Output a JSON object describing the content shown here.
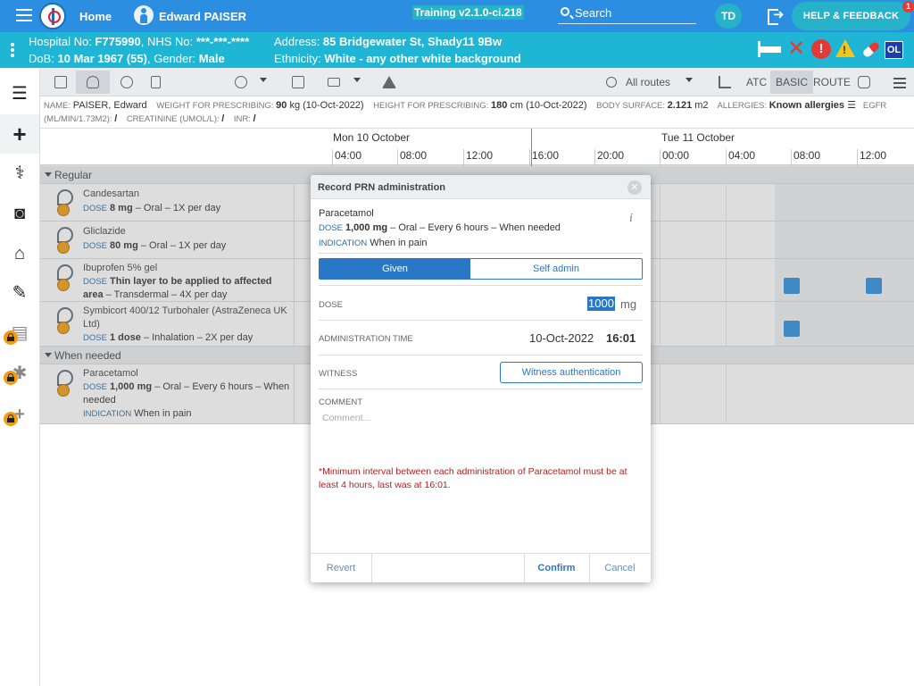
{
  "topbar": {
    "home_label": "Home",
    "patient_name": "Edward PAISER",
    "build": "Training v2.1.0-ci.218",
    "search_label": "Search",
    "user_initials": "TD",
    "help_label": "HELP & FEEDBACK",
    "notification_count": "1"
  },
  "banner": {
    "line1_left_k1": "Hospital No: ",
    "line1_left_v1": "F775990",
    "line1_left_k2": ", NHS No: ",
    "line1_left_v2": "***-***-****",
    "line2_left_k1": "DoB: ",
    "line2_left_v1": "10 Mar 1967 (55)",
    "line2_left_k2": ", Gender: ",
    "line2_left_v2": "Male",
    "line1_right_k": "Address: ",
    "line1_right_v": "85 Bridgewater St, Shady11 9Bw",
    "line2_right_k": "Ethnicity: ",
    "line2_right_v": "White - any other white background",
    "ol_badge": "OL"
  },
  "toolbar": {
    "routes_label": "All routes",
    "atc_label": "ATC",
    "basic_label": "BASIC",
    "route_label": "ROUTE"
  },
  "info_strip": {
    "name_k": "Name: ",
    "name_v": "PAISER, Edward",
    "weight_k": "Weight for prescribing: ",
    "weight_v": "90",
    "weight_u": " kg (10-Oct-2022)",
    "height_k": "Height for prescribing: ",
    "height_v": "180",
    "height_u": " cm (10-Oct-2022)",
    "bsa_k": "Body surface: ",
    "bsa_v": "2.121",
    "bsa_u": " m2",
    "allergies_k": "Allergies: ",
    "allergies_v": "Known allergies",
    "allergies_sym": " ☰",
    "egfr_k": "eGFR",
    "egfr_k2": "(mL/min/1.73m2): ",
    "egfr_v": "/",
    "creat_k": "Creatinine (umol/L): ",
    "creat_v": "/",
    "inr_k": "INR: ",
    "inr_v": "/"
  },
  "timeline": {
    "day1": "Mon 10 October",
    "day2": "Tue 11 October",
    "hours": [
      "04:00",
      "08:00",
      "12:00",
      "16:00",
      "20:00",
      "00:00",
      "04:00",
      "08:00",
      "12:00"
    ]
  },
  "sections": {
    "regular": "Regular",
    "when_needed": "When needed"
  },
  "meds": [
    {
      "name": "Candesartan",
      "dose_k": "DOSE",
      "dose_v": "8 mg",
      "rest": " – Oral – 1X per day"
    },
    {
      "name": "Gliclazide",
      "dose_k": "DOSE",
      "dose_v": "80 mg",
      "rest": " – Oral – 1X per day"
    },
    {
      "name": "Ibuprofen 5% gel",
      "dose_k": "DOSE",
      "dose_v": "Thin layer to be applied to affected area",
      "rest": " – Transdermal – 4X per day"
    },
    {
      "name": "Symbicort 400/12 Turbohaler (AstraZeneca UK Ltd)",
      "dose_k": "DOSE",
      "dose_v": "1 dose",
      "rest": " – Inhalation – 2X per day"
    },
    {
      "name": "Paracetamol",
      "dose_k": "DOSE",
      "dose_v": "1,000 mg",
      "rest": " – Oral – Every 6 hours – When needed",
      "ind_k": "INDICATION",
      "ind_v": " When in pain"
    }
  ],
  "modal": {
    "title": "Record PRN administration",
    "drug_name": "Paracetamol",
    "dose_k": "DOSE",
    "dose_v": "1,000 mg",
    "dose_rest": " – Oral – Every 6 hours – When needed",
    "ind_k": "INDICATION",
    "ind_v": " When in pain",
    "given_label": "Given",
    "self_admin_label": "Self admin",
    "dose_label": "Dose",
    "dose_value": "1000",
    "dose_unit": "mg",
    "admin_time_label": "Administration time",
    "admin_date": "10-Oct-2022",
    "admin_time": "16:01",
    "witness_label": "Witness",
    "witness_button": "Witness authentication",
    "comment_label": "Comment",
    "comment_placeholder": "Comment...",
    "warning": "*Minimum interval between each administration of Paracetamol must be at least 4 hours, last was at 16:01.",
    "revert_label": "Revert",
    "confirm_label": "Confirm",
    "cancel_label": "Cancel"
  },
  "colors": {
    "topbar": "#2b8ee0",
    "banner": "#1fb6d5",
    "accent": "#2b77c7",
    "warning": "#b22222",
    "lock": "#f39c12"
  }
}
